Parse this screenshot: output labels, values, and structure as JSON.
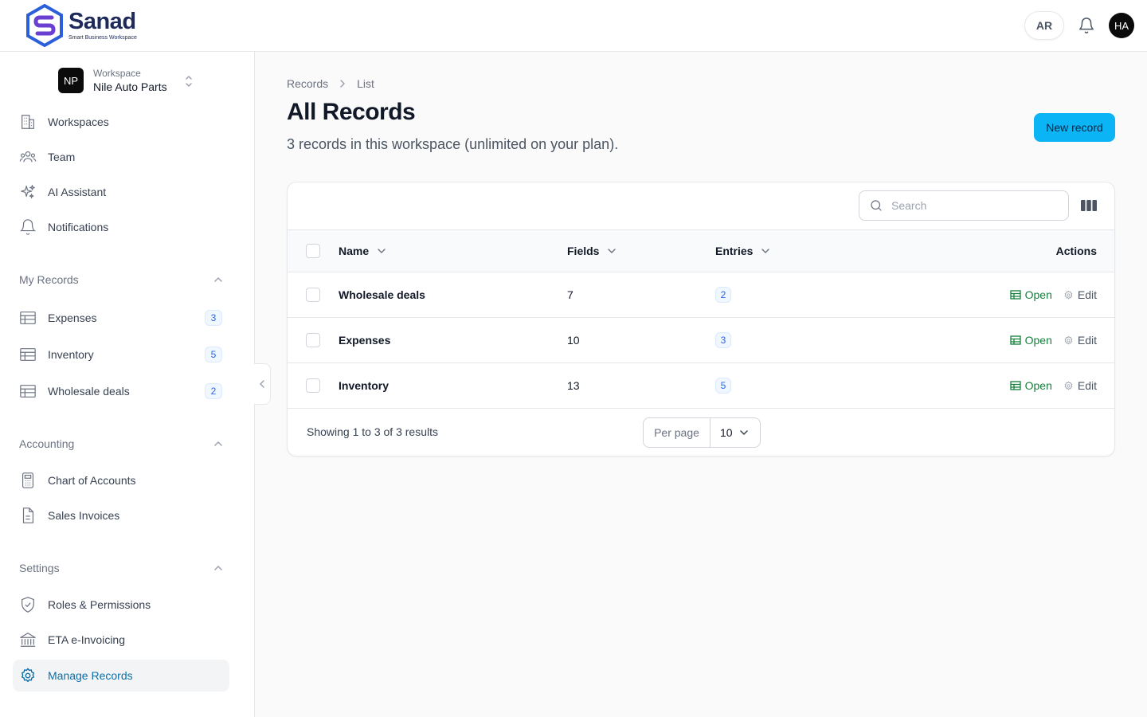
{
  "app": {
    "name": "Sanad",
    "tagline": "Smart Business Workspace",
    "lang_toggle": "AR",
    "user_initials": "HA"
  },
  "workspace": {
    "label": "Workspace",
    "name": "Nile Auto Parts",
    "initials": "NP"
  },
  "sidebar": {
    "main_items": [
      {
        "label": "Workspaces",
        "icon": "building-icon"
      },
      {
        "label": "Team",
        "icon": "users-icon"
      },
      {
        "label": "AI Assistant",
        "icon": "sparkles-icon"
      },
      {
        "label": "Notifications",
        "icon": "bell-icon"
      }
    ],
    "groups": {
      "my_records": {
        "title": "My Records",
        "items": [
          {
            "label": "Expenses",
            "count": "3",
            "icon": "table-icon"
          },
          {
            "label": "Inventory",
            "count": "5",
            "icon": "table-icon"
          },
          {
            "label": "Wholesale deals",
            "count": "2",
            "icon": "table-icon"
          }
        ]
      },
      "accounting": {
        "title": "Accounting",
        "items": [
          {
            "label": "Chart of Accounts",
            "icon": "calculator-icon"
          },
          {
            "label": "Sales Invoices",
            "icon": "document-icon"
          }
        ]
      },
      "settings": {
        "title": "Settings",
        "items": [
          {
            "label": "Roles & Permissions",
            "icon": "shield-check-icon"
          },
          {
            "label": "ETA e-Invoicing",
            "icon": "bank-icon"
          },
          {
            "label": "Manage Records",
            "icon": "gear-icon",
            "active": true
          }
        ]
      }
    }
  },
  "breadcrumb": [
    "Records",
    "List"
  ],
  "page": {
    "title": "All Records",
    "subtitle": "3 records in this workspace (unlimited on your plan).",
    "new_button": "New record"
  },
  "table": {
    "search_placeholder": "Search",
    "headers": {
      "name": "Name",
      "fields": "Fields",
      "entries": "Entries",
      "actions": "Actions"
    },
    "rows": [
      {
        "name": "Wholesale deals",
        "fields": "7",
        "entries": "2"
      },
      {
        "name": "Expenses",
        "fields": "10",
        "entries": "3"
      },
      {
        "name": "Inventory",
        "fields": "13",
        "entries": "5"
      }
    ],
    "open_label": "Open",
    "edit_label": "Edit",
    "footer": "Showing 1 to 3 of 3 results",
    "per_page_label": "Per page",
    "per_page_value": "10"
  },
  "colors": {
    "accent": "#0ab4f5",
    "active_nav_text": "#0b6ea8",
    "open_action": "#15803d",
    "count_badge": "#2563eb",
    "logo_primary": "#2b5fd9"
  }
}
